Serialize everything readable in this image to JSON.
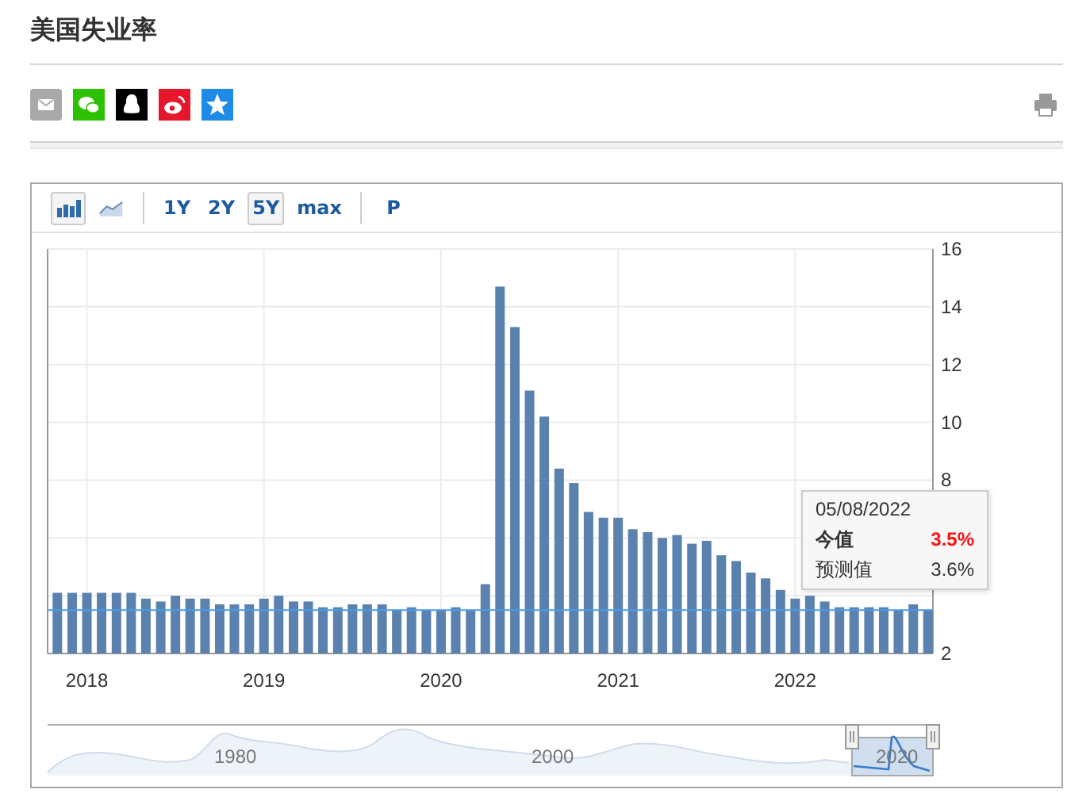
{
  "page": {
    "title": "美国失业率"
  },
  "toolbar": {
    "chart_types": [
      {
        "kind": "bar",
        "selected": true
      },
      {
        "kind": "line",
        "selected": false
      }
    ],
    "ranges": [
      {
        "label": "1Y",
        "selected": false
      },
      {
        "label": "2Y",
        "selected": false
      },
      {
        "label": "5Y",
        "selected": true
      },
      {
        "label": "max",
        "selected": false
      }
    ],
    "p_button": {
      "label": "P",
      "selected": false
    }
  },
  "chart": {
    "chart_data": {
      "type": "bar",
      "x": [
        2017.833,
        2017.917,
        2018.0,
        2018.083,
        2018.167,
        2018.25,
        2018.333,
        2018.417,
        2018.5,
        2018.583,
        2018.667,
        2018.75,
        2018.833,
        2018.917,
        2019.0,
        2019.083,
        2019.167,
        2019.25,
        2019.333,
        2019.417,
        2019.5,
        2019.583,
        2019.667,
        2019.75,
        2019.833,
        2019.917,
        2020.0,
        2020.083,
        2020.167,
        2020.25,
        2020.333,
        2020.417,
        2020.5,
        2020.583,
        2020.667,
        2020.75,
        2020.833,
        2020.917,
        2021.0,
        2021.083,
        2021.167,
        2021.25,
        2021.333,
        2021.417,
        2021.5,
        2021.583,
        2021.667,
        2021.75,
        2021.833,
        2021.917,
        2022.0,
        2022.083,
        2022.167,
        2022.25,
        2022.333,
        2022.417,
        2022.5,
        2022.583,
        2022.667,
        2022.75
      ],
      "series": [
        {
          "color": "#5b82ae",
          "values": [
            4.1,
            4.1,
            4.1,
            4.1,
            4.1,
            4.1,
            3.9,
            3.8,
            4.0,
            3.9,
            3.9,
            3.7,
            3.7,
            3.7,
            3.9,
            4.0,
            3.8,
            3.8,
            3.6,
            3.6,
            3.7,
            3.7,
            3.7,
            3.5,
            3.6,
            3.5,
            3.5,
            3.6,
            3.5,
            4.4,
            14.7,
            13.3,
            11.1,
            10.2,
            8.4,
            7.9,
            6.9,
            6.7,
            6.7,
            6.3,
            6.2,
            6.0,
            6.1,
            5.8,
            5.9,
            5.4,
            5.2,
            4.8,
            4.6,
            4.2,
            3.9,
            4.0,
            3.8,
            3.6,
            3.6,
            3.6,
            3.6,
            3.5,
            3.7,
            3.5
          ]
        }
      ],
      "ylim": [
        2,
        16
      ],
      "yticks": [
        2,
        8,
        10,
        12,
        14,
        16
      ],
      "xlim": [
        2017.778,
        2022.778
      ],
      "xticks": [
        2018,
        2019,
        2020,
        2021,
        2022
      ],
      "grid": true,
      "ref_lines": [
        {
          "axis": "y",
          "value": 3.5,
          "color": "#4a9be8"
        }
      ]
    },
    "tooltip": {
      "date": "05/08/2022",
      "rows": [
        {
          "kind": "actual",
          "label": "今值",
          "value": "3.5%"
        },
        {
          "kind": "forecast",
          "label": "预测值",
          "value": "3.6%"
        }
      ]
    },
    "navigator": {
      "labels": [
        "1980",
        "2000",
        "2020"
      ]
    }
  }
}
